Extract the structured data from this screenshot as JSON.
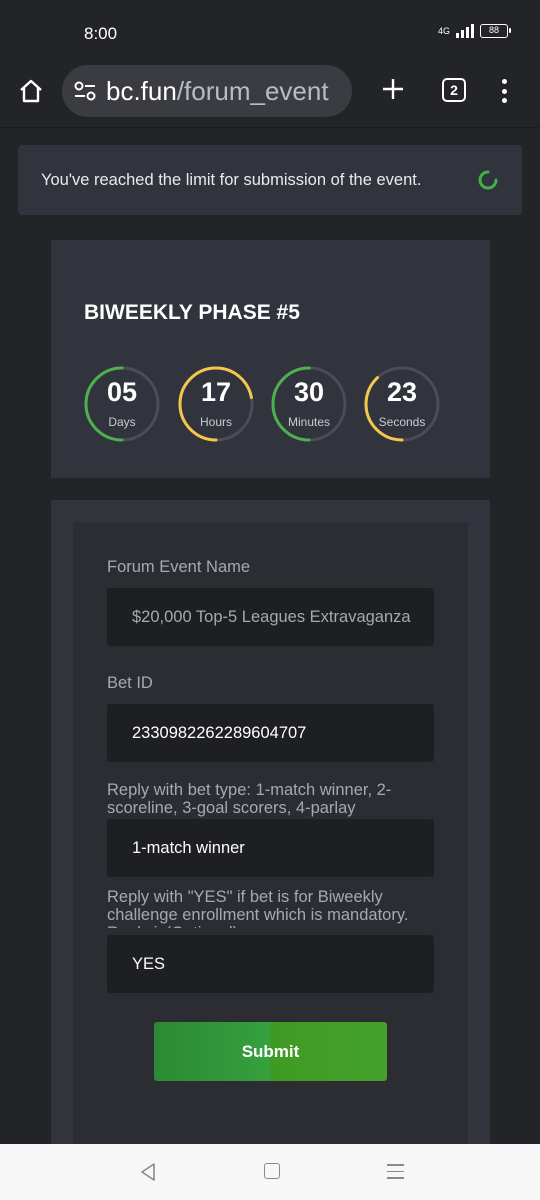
{
  "status_bar": {
    "time": "8:00",
    "network": "4G",
    "battery": "88"
  },
  "browser": {
    "url_domain": "bc.fun",
    "url_path": "/forum_event",
    "tab_count": "2"
  },
  "alert": {
    "message": "You've reached the limit for submission of the event."
  },
  "phase": {
    "title": "BIWEEKLY PHASE #5",
    "timers": [
      {
        "value": "05",
        "unit": "Days",
        "fraction": 0.5,
        "color": "#4caf50"
      },
      {
        "value": "17",
        "unit": "Hours",
        "fraction": 0.72,
        "color": "#f4c64d"
      },
      {
        "value": "30",
        "unit": "Minutes",
        "fraction": 0.5,
        "color": "#4caf50"
      },
      {
        "value": "23",
        "unit": "Seconds",
        "fraction": 0.38,
        "color": "#f4c64d"
      }
    ]
  },
  "form": {
    "event_name_label": "Forum Event Name",
    "event_name_value": "$20,000 Top-5 Leagues Extravaganza",
    "bet_id_label": "Bet ID",
    "bet_id_value": "2330982262289604707",
    "bet_type_label": "Reply with bet type: 1-match winner, 2-scoreline, 3-goal scorers, 4-parlay",
    "bet_type_value": "1-match winner",
    "biweekly_label": "Reply with \"YES\" if bet is for Biweekly challenge enrollment which is mandatory. Reply is(Optional)",
    "biweekly_value": "YES",
    "submit_label": "Submit"
  },
  "colors": {
    "accent_green": "#3a9a35",
    "timer_track": "#4a4d55"
  }
}
